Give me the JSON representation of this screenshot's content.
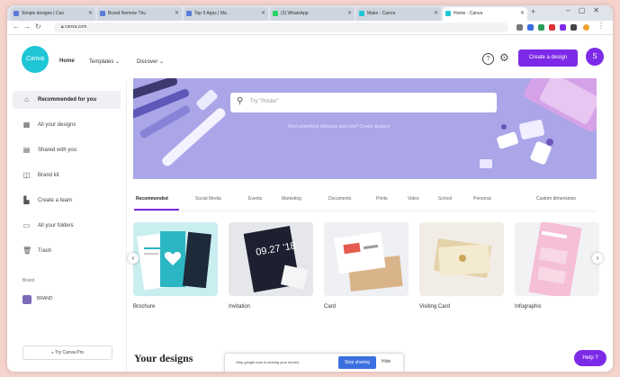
{
  "browser": {
    "tabs": [
      {
        "label": "Simple designs | Can",
        "active": false
      },
      {
        "label": "Brand Remote Thu",
        "active": false
      },
      {
        "label": "Top 5 Apps | Ma",
        "active": false
      },
      {
        "label": "(3) WhatsApp",
        "active": false
      },
      {
        "label": "Make - Canva",
        "active": false
      },
      {
        "label": "Home - Canva",
        "active": true
      }
    ],
    "url": "canva.com"
  },
  "header": {
    "logo_text": "Canva",
    "nav": [
      {
        "label": "Home",
        "active": true
      },
      {
        "label": "Templates ⌄",
        "active": false
      },
      {
        "label": "Discover ⌄",
        "active": false
      }
    ],
    "help_glyph": "?",
    "create_label": "Create a design",
    "avatar_initial": "S"
  },
  "sidebar": {
    "items": [
      {
        "label": "Recommended for you",
        "icon": "home-icon",
        "active": true
      },
      {
        "label": "All your designs",
        "icon": "grid-icon",
        "active": false
      },
      {
        "label": "Shared with you",
        "icon": "share-icon",
        "active": false
      },
      {
        "label": "Brand kit",
        "icon": "brand-icon",
        "active": false
      },
      {
        "label": "Create a team",
        "icon": "team-icon",
        "active": false
      },
      {
        "label": "All your folders",
        "icon": "folder-icon",
        "active": false
      },
      {
        "label": "Trash",
        "icon": "trash-icon",
        "active": false
      }
    ],
    "section_label": "Brand",
    "brand_name": "BRAND",
    "try_pro_label": "⭑ Try Canva Pro"
  },
  "hero": {
    "search_placeholder": "Try \"Poster\"",
    "subtitle": "Find something delicious and new? Create designs"
  },
  "category_tabs": [
    {
      "label": "Recommended",
      "active": true
    },
    {
      "label": "Social Media",
      "active": false
    },
    {
      "label": "Events",
      "active": false
    },
    {
      "label": "Marketing",
      "active": false
    },
    {
      "label": "Documents",
      "active": false
    },
    {
      "label": "Prints",
      "active": false
    },
    {
      "label": "Video",
      "active": false
    },
    {
      "label": "School",
      "active": false
    },
    {
      "label": "Personal",
      "active": false
    }
  ],
  "custom_dimensions_label": "Custom dimensions",
  "cards": [
    {
      "label": "Brochure"
    },
    {
      "label": "Invitation",
      "art_text": "09.27 '18"
    },
    {
      "label": "Card"
    },
    {
      "label": "Visiting Card"
    },
    {
      "label": "Infographic"
    }
  ],
  "your_designs_label": "Your designs",
  "banner": {
    "text": "Help google.com is sharing your screen.",
    "button_label": "Stop sharing",
    "hide_label": "Hide"
  },
  "help_button_label": "Help ?",
  "colors": {
    "accent": "#7d2ae8",
    "hero_bg": "#aaa6e8",
    "logo": "#1fc6d6",
    "page_bg": "#f6d3cd"
  }
}
